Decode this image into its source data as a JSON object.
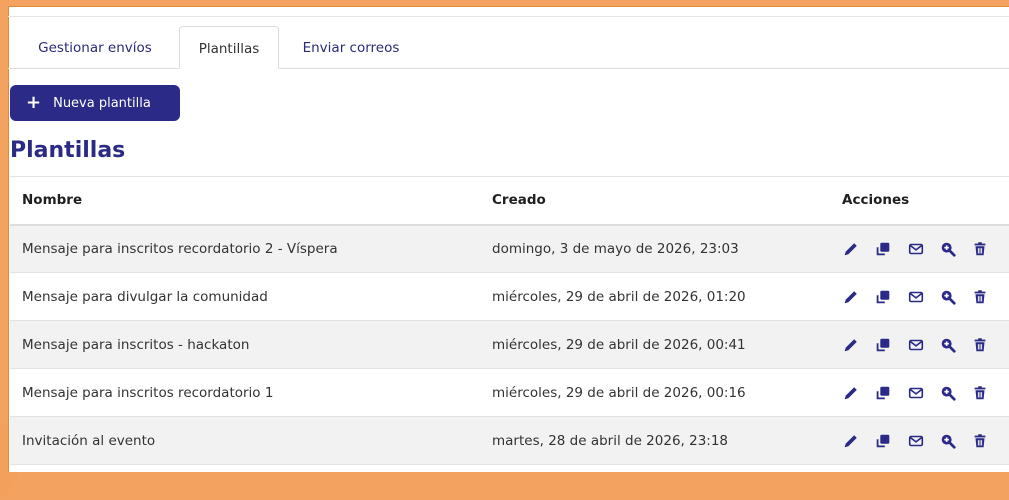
{
  "tabs": [
    {
      "label": "Gestionar envíos"
    },
    {
      "label": "Plantillas"
    },
    {
      "label": "Enviar correos"
    }
  ],
  "new_button": {
    "label": "Nueva plantilla"
  },
  "page_title": "Plantillas",
  "table": {
    "headers": {
      "name": "Nombre",
      "created": "Creado",
      "actions": "Acciones"
    },
    "rows": [
      {
        "name": "Mensaje para inscritos recordatorio 2 - Víspera",
        "created": "domingo, 3 de mayo de 2026, 23:03"
      },
      {
        "name": "Mensaje para divulgar la comunidad",
        "created": "miércoles, 29 de abril de 2026, 01:20"
      },
      {
        "name": "Mensaje para inscritos - hackaton",
        "created": "miércoles, 29 de abril de 2026, 00:41"
      },
      {
        "name": "Mensaje para inscritos recordatorio 1",
        "created": "miércoles, 29 de abril de 2026, 00:16"
      },
      {
        "name": "Invitación al evento",
        "created": "martes, 28 de abril de 2026, 23:18"
      }
    ]
  },
  "action_icons": [
    "edit-icon",
    "duplicate-icon",
    "mail-icon",
    "preview-icon",
    "delete-icon"
  ],
  "colors": {
    "accent": "#2b2a86",
    "tab_text": "#2b2a7a",
    "frame": "#f4a25f"
  }
}
